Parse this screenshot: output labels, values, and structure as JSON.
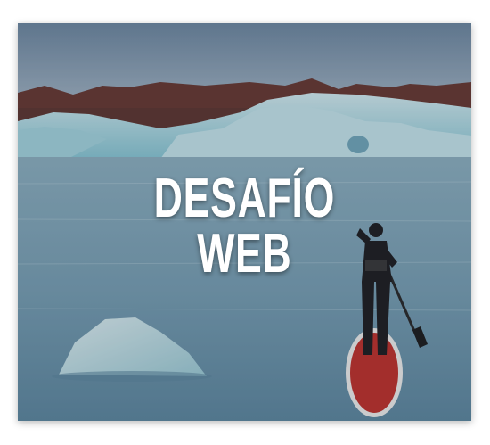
{
  "card": {
    "title_line1": "DESAFÍO",
    "title_line2": "WEB"
  },
  "colors": {
    "sky": "#7d97ad",
    "mountains": "#6b3a32",
    "ice": "#b9e3ea",
    "water": "#8fb6c6",
    "board": "#c2332d",
    "title": "#ffffff"
  }
}
